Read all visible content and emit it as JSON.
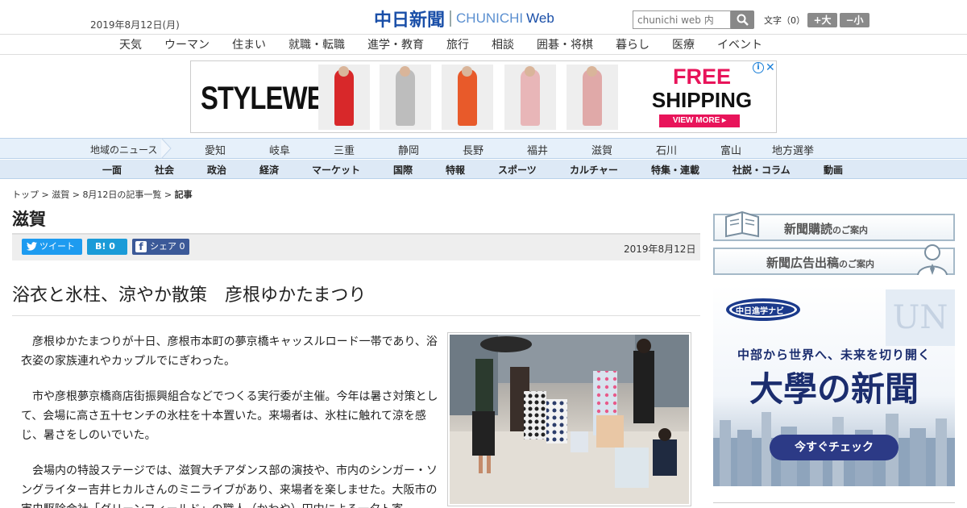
{
  "header": {
    "date": "2019年8月12日(月)",
    "logo_kanji": "中日新聞",
    "logo_en": "CHUNICHI",
    "logo_web": "Web",
    "search_placeholder": "chunichi web 内",
    "font_size_label": "文字（0）",
    "font_plus": "+大",
    "font_minus": "−小"
  },
  "topnav": [
    "天気",
    "ウーマン",
    "住まい",
    "就職・転職",
    "進学・教育",
    "旅行",
    "相談",
    "囲碁・将棋",
    "暮らし",
    "医療",
    "イベント"
  ],
  "ad": {
    "brand": "STYLEWE",
    "free": "FREE",
    "shipping": "SHIPPING",
    "cta": "VIEW MORE ▸",
    "info": "i",
    "close": "✕",
    "dress_colors": [
      "#d8282a",
      "#bdbdbd",
      "#e85a2a",
      "#e8b6b8",
      "#e0a9a8"
    ]
  },
  "region_nav": {
    "label": "地域のニュース",
    "items": [
      "愛知",
      "岐阜",
      "三重",
      "静岡",
      "長野",
      "福井",
      "滋賀",
      "石川",
      "富山",
      "地方選挙"
    ]
  },
  "category_nav": [
    "一面",
    "社会",
    "政治",
    "経済",
    "マーケット",
    "国際",
    "特報",
    "スポーツ",
    "カルチャー",
    "特集・連載",
    "社説・コラム",
    "動画"
  ],
  "breadcrumb": {
    "top": "トップ",
    "region": "滋賀",
    "list": "8月12日の記事一覧",
    "current": "記事"
  },
  "article": {
    "section": "滋賀",
    "tweet": "ツイート",
    "hatena": "B! 0",
    "fb_share": "シェア 0",
    "date": "2019年8月12日",
    "headline": "浴衣と氷柱、涼やか散策　彦根ゆかたまつり",
    "paragraphs": [
      "彦根ゆかたまつりが十日、彦根市本町の夢京橋キャッスルロード一帯であり、浴衣姿の家族連れやカップルでにぎわった。",
      "市や彦根夢京橋商店街振興組合などでつくる実行委が主催。今年は暑さ対策として、会場に高さ五十センチの氷柱を十本置いた。来場者は、氷柱に触れて涼を感じ、暑さをしのいでいた。",
      "会場内の特設ステージでは、滋賀大チアダンス部の演技や、市内のシンガー・ソングライター吉井ヒカルさんのミニライブがあり、来場者を楽しませた。大阪市の害虫駆除会社「グリーンフィールド」の職人（かわや）田中による一夕ト寄"
    ]
  },
  "sidebar": {
    "subscribe": "新聞購読",
    "subscribe_small": "のご案内",
    "advertise": "新聞広告出稿",
    "advertise_small": "のご案内",
    "uni_logo": "中日進学ナビ",
    "uni_tagline": "中部から世界へ、未来を切り開く",
    "uni_title": "大學の新聞",
    "uni_cta": "今すぐチェック",
    "uni_mark": "UN"
  }
}
